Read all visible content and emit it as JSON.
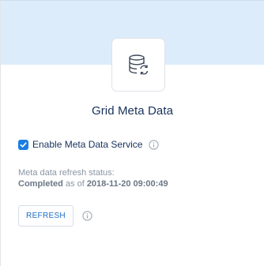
{
  "card": {
    "title": "Grid Meta Data",
    "icon": "database-sync-icon"
  },
  "enable_service": {
    "label": "Enable Meta Data Service",
    "checked": true,
    "info_icon": "info-icon"
  },
  "status": {
    "label": "Meta data refresh status:",
    "state": "Completed",
    "as_of_text": " as of ",
    "timestamp": "2018-11-20 09:00:49"
  },
  "refresh": {
    "label": "REFRESH",
    "info_icon": "info-icon"
  },
  "colors": {
    "header_band": "#dcecfa",
    "accent": "#1b7de3",
    "title_text": "#16325c",
    "muted_text": "#8a95a3"
  }
}
